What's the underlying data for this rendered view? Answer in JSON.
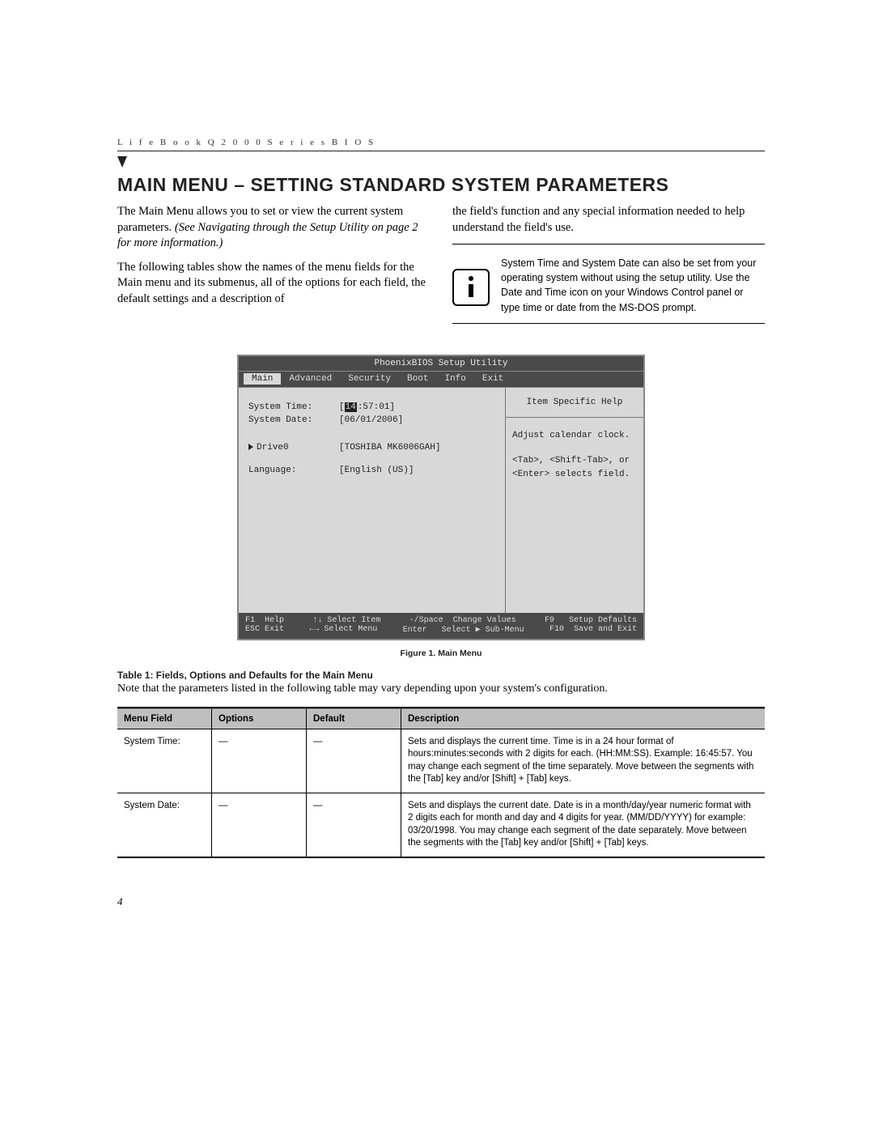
{
  "runhead": "L i f e B o o k   Q 2 0 0 0   S e r i e s   B I O S",
  "title": "MAIN MENU – SETTING STANDARD SYSTEM PARAMETERS",
  "para1_a": "The Main Menu allows you to set or view the current system parameters. ",
  "para1_b": "(See Navigating through the Setup Utility on page 2 for more information.)",
  "para2": "The following tables show the names of the menu fields for the Main menu and its submenus, all of the options for each field, the default settings and a description of",
  "para_right": "the field's function and any special information needed to help understand the field's use.",
  "info_text": "System Time and System Date can also be set from your operating system without using the setup utility. Use the Date and Time icon on your Windows Control panel or type time or date from the MS-DOS prompt.",
  "bios": {
    "title": "PhoenixBIOS Setup Utility",
    "tabs": [
      "Main",
      "Advanced",
      "Security",
      "Boot",
      "Info",
      "Exit"
    ],
    "rows": {
      "time_label": "System Time:",
      "time_value_prefix": "[",
      "time_value_cursor": "14",
      "time_value_rest": ":57:01]",
      "date_label": "System Date:",
      "date_value": "[06/01/2006]",
      "drive_label": "Drive0",
      "drive_value": "[TOSHIBA MK6006GAH]",
      "lang_label": "Language:",
      "lang_value": "[English (US)]"
    },
    "help_title": "Item Specific Help",
    "help_body1": "Adjust calendar clock.",
    "help_body2": "<Tab>, <Shift-Tab>, or <Enter> selects field.",
    "footer": {
      "f1": "F1  Help",
      "sel_item": "↑↓ Select Item",
      "change": "-/Space  Change Values",
      "f9": "F9   Setup Defaults",
      "esc": "ESC Exit",
      "sel_menu": "←→ Select Menu",
      "enter": "Enter   Select ▶ Sub-Menu",
      "f10": "F10  Save and Exit"
    }
  },
  "figure_caption": "Figure 1.  Main Menu",
  "table_caption": "Table 1: Fields, Options and Defaults for the Main Menu",
  "table_note": "Note that the parameters listed in the following table may vary depending upon your system's configuration.",
  "table": {
    "headers": [
      "Menu Field",
      "Options",
      "Default",
      "Description"
    ],
    "rows": [
      {
        "field": "System Time:",
        "options": "—",
        "default": "—",
        "desc": "Sets and displays the current time. Time is in a 24 hour format of hours:minutes:seconds with 2 digits for each. (HH:MM:SS). Example: 16:45:57. You may change each segment of the time separately. Move between the segments with the [Tab] key and/or [Shift] + [Tab] keys."
      },
      {
        "field": "System Date:",
        "options": "—",
        "default": "—",
        "desc": "Sets and displays the current date. Date is in a month/day/year numeric format with 2 digits each for month and day and 4 digits for year. (MM/DD/YYYY) for example: 03/20/1998. You may change each segment of the date separately. Move between the segments with the [Tab] key and/or [Shift] + [Tab] keys."
      }
    ]
  },
  "page_number": "4"
}
